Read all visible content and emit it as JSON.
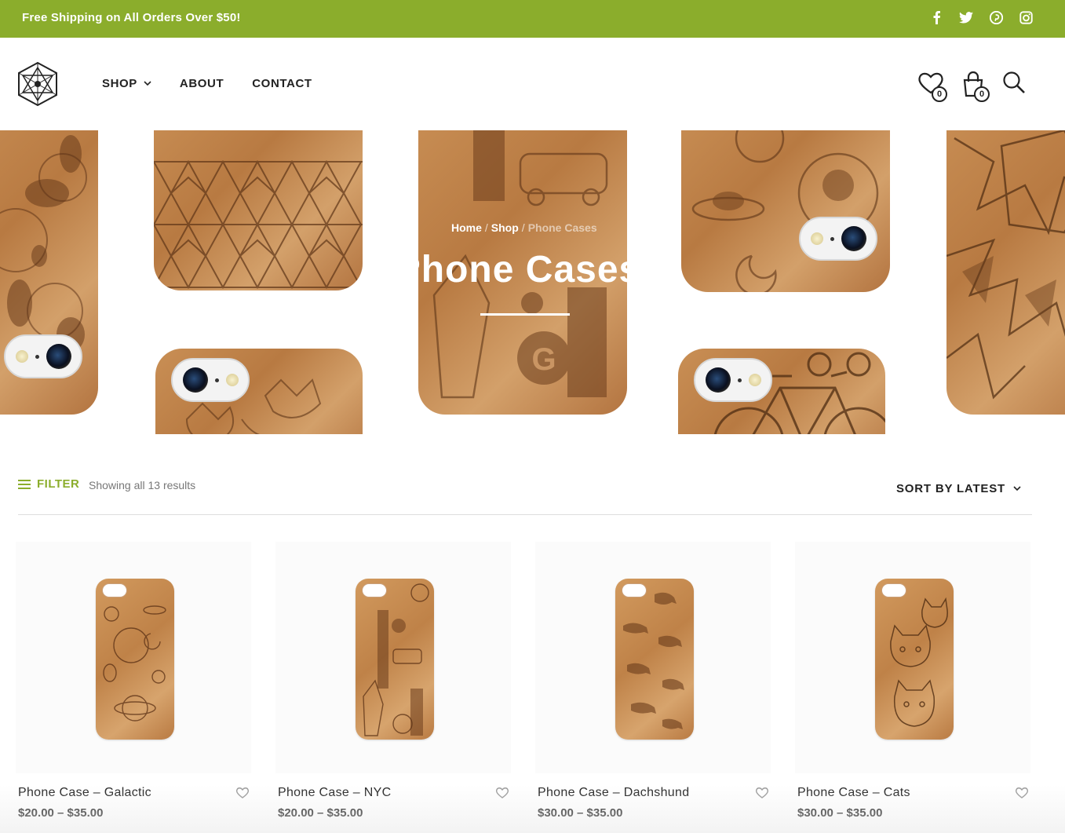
{
  "topbar": {
    "promo": "Free Shipping on All Orders Over $50!",
    "social": [
      "facebook-icon",
      "twitter-icon",
      "pinterest-icon",
      "instagram-icon"
    ],
    "background": "#8bad2c"
  },
  "header": {
    "nav": [
      {
        "label": "SHOP",
        "has_dropdown": true
      },
      {
        "label": "ABOUT",
        "has_dropdown": false
      },
      {
        "label": "CONTACT",
        "has_dropdown": false
      }
    ],
    "wishlist_count": "0",
    "cart_count": "0"
  },
  "hero": {
    "breadcrumb": {
      "home": "Home",
      "shop": "Shop",
      "current": "Phone Cases",
      "separator": "/"
    },
    "title": "Phone Cases"
  },
  "toolbar": {
    "filter_label": "FILTER",
    "results_text": "Showing all 13 results",
    "sort_label": "SORT BY LATEST"
  },
  "products": [
    {
      "name": "Phone Case – Galactic",
      "price": "$20.00 – $35.00"
    },
    {
      "name": "Phone Case – NYC",
      "price": "$20.00 – $35.00"
    },
    {
      "name": "Phone Case – Dachshund",
      "price": "$30.00 – $35.00"
    },
    {
      "name": "Phone Case – Cats",
      "price": "$30.00 – $35.00"
    }
  ],
  "colors": {
    "accent": "#8bad2c",
    "text": "#222222",
    "wood": "#c48a50"
  }
}
